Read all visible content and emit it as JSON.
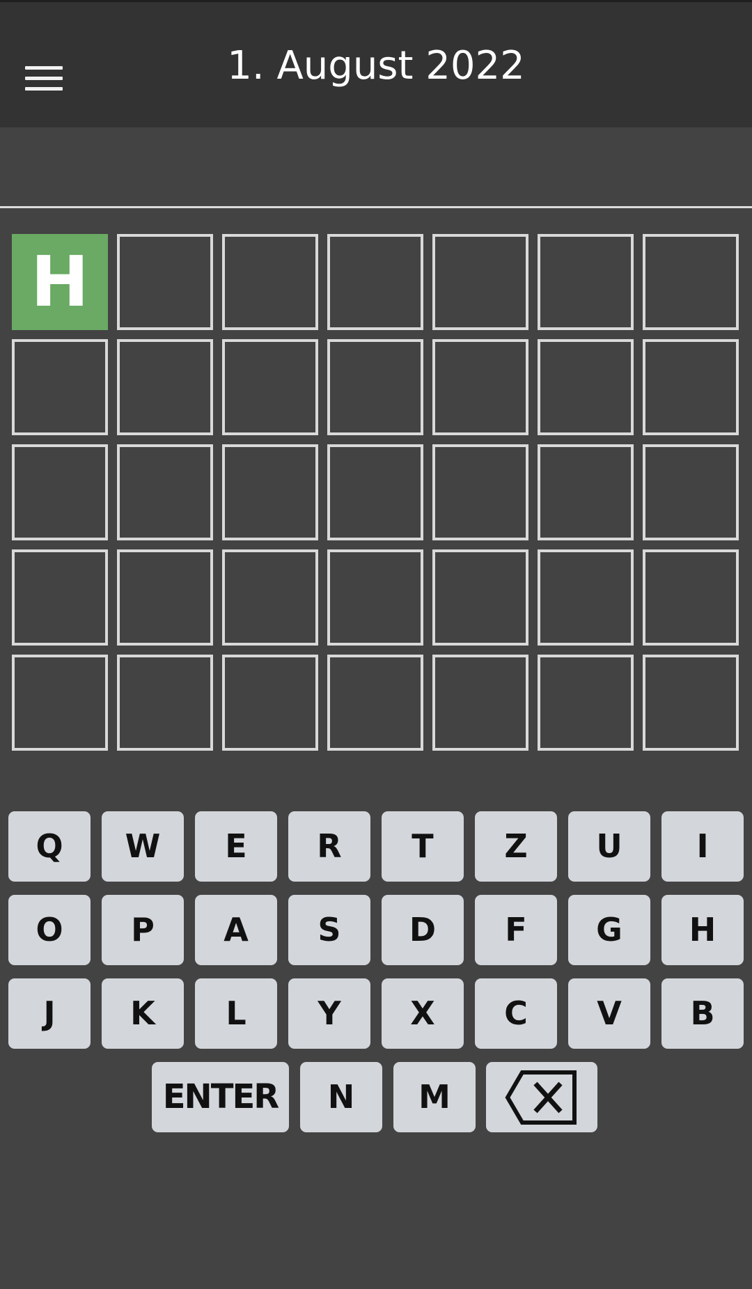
{
  "header": {
    "title": "1. August 2022",
    "menu_icon": "hamburger-menu-icon"
  },
  "board": {
    "rows": [
      [
        {
          "letter": "H",
          "state": "correct"
        },
        {
          "letter": "",
          "state": "empty"
        },
        {
          "letter": "",
          "state": "empty"
        },
        {
          "letter": "",
          "state": "empty"
        },
        {
          "letter": "",
          "state": "empty"
        },
        {
          "letter": "",
          "state": "empty"
        },
        {
          "letter": "",
          "state": "empty"
        }
      ],
      [
        {
          "letter": "",
          "state": "empty"
        },
        {
          "letter": "",
          "state": "empty"
        },
        {
          "letter": "",
          "state": "empty"
        },
        {
          "letter": "",
          "state": "empty"
        },
        {
          "letter": "",
          "state": "empty"
        },
        {
          "letter": "",
          "state": "empty"
        },
        {
          "letter": "",
          "state": "empty"
        }
      ],
      [
        {
          "letter": "",
          "state": "empty"
        },
        {
          "letter": "",
          "state": "empty"
        },
        {
          "letter": "",
          "state": "empty"
        },
        {
          "letter": "",
          "state": "empty"
        },
        {
          "letter": "",
          "state": "empty"
        },
        {
          "letter": "",
          "state": "empty"
        },
        {
          "letter": "",
          "state": "empty"
        }
      ],
      [
        {
          "letter": "",
          "state": "empty"
        },
        {
          "letter": "",
          "state": "empty"
        },
        {
          "letter": "",
          "state": "empty"
        },
        {
          "letter": "",
          "state": "empty"
        },
        {
          "letter": "",
          "state": "empty"
        },
        {
          "letter": "",
          "state": "empty"
        },
        {
          "letter": "",
          "state": "empty"
        }
      ],
      [
        {
          "letter": "",
          "state": "empty"
        },
        {
          "letter": "",
          "state": "empty"
        },
        {
          "letter": "",
          "state": "empty"
        },
        {
          "letter": "",
          "state": "empty"
        },
        {
          "letter": "",
          "state": "empty"
        },
        {
          "letter": "",
          "state": "empty"
        },
        {
          "letter": "",
          "state": "empty"
        }
      ]
    ]
  },
  "keyboard": {
    "rows": [
      [
        "Q",
        "W",
        "E",
        "R",
        "T",
        "Z",
        "U",
        "I"
      ],
      [
        "O",
        "P",
        "A",
        "S",
        "D",
        "F",
        "G",
        "H"
      ],
      [
        "J",
        "K",
        "L",
        "Y",
        "X",
        "C",
        "V",
        "B"
      ]
    ],
    "bottom_row": {
      "enter_label": "ENTER",
      "letters": [
        "N",
        "M"
      ],
      "backspace_icon": "backspace-icon"
    }
  },
  "colors": {
    "background": "#434343",
    "header": "#333333",
    "correct": "#6aaa64",
    "tile_border": "#d9d9d9",
    "key": "#d3d6da",
    "key_text": "#111111"
  }
}
